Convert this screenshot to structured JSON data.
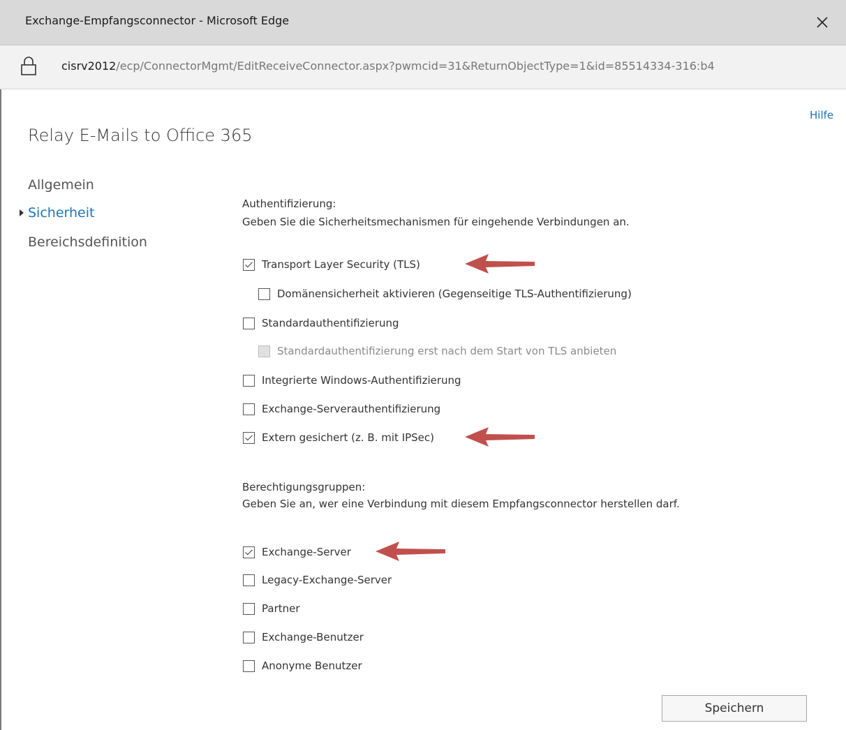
{
  "window": {
    "title": "Exchange-Empfangsconnector - Microsoft Edge",
    "close_icon": "close-icon"
  },
  "address_bar": {
    "host": "cisrv2012",
    "path": "/ecp/ConnectorMgmt/EditReceiveConnector.aspx?pwmcid=31&ReturnObjectType=1&id=85514334-316:b4",
    "lock_icon": "lock-icon"
  },
  "help_link": "Hilfe",
  "page_title": "Relay E-Mails to Office 365",
  "nav": {
    "items": [
      {
        "label": "Allgemein",
        "active": false
      },
      {
        "label": "Sicherheit",
        "active": true
      },
      {
        "label": "Bereichsdefinition",
        "active": false
      }
    ]
  },
  "authentication": {
    "heading": "Authentifizierung:",
    "description": "Geben Sie die Sicherheitsmechanismen für eingehende Verbindungen an.",
    "options": [
      {
        "label": "Transport Layer Security (TLS)",
        "checked": true,
        "enabled": true
      },
      {
        "label": "Domänensicherheit aktivieren (Gegenseitige TLS-Authentifizierung)",
        "checked": false,
        "enabled": true
      },
      {
        "label": "Standardauthentifizierung",
        "checked": false,
        "enabled": true
      },
      {
        "label": "Standardauthentifizierung erst nach dem Start von TLS anbieten",
        "checked": false,
        "enabled": false
      },
      {
        "label": "Integrierte Windows-Authentifizierung",
        "checked": false,
        "enabled": true
      },
      {
        "label": "Exchange-Serverauthentifizierung",
        "checked": false,
        "enabled": true
      },
      {
        "label": "Extern gesichert (z. B. mit IPSec)",
        "checked": true,
        "enabled": true
      }
    ]
  },
  "permission_groups": {
    "heading": "Berechtigungsgruppen:",
    "description": "Geben Sie an, wer eine Verbindung mit diesem Empfangsconnector herstellen darf.",
    "options": [
      {
        "label": "Exchange-Server",
        "checked": true,
        "enabled": true
      },
      {
        "label": "Legacy-Exchange-Server",
        "checked": false,
        "enabled": true
      },
      {
        "label": "Partner",
        "checked": false,
        "enabled": true
      },
      {
        "label": "Exchange-Benutzer",
        "checked": false,
        "enabled": true
      },
      {
        "label": "Anonyme Benutzer",
        "checked": false,
        "enabled": true
      }
    ]
  },
  "save_button": "Speichern",
  "colors": {
    "accent": "#1f73b7",
    "annotation_arrow": "#c0504d"
  }
}
